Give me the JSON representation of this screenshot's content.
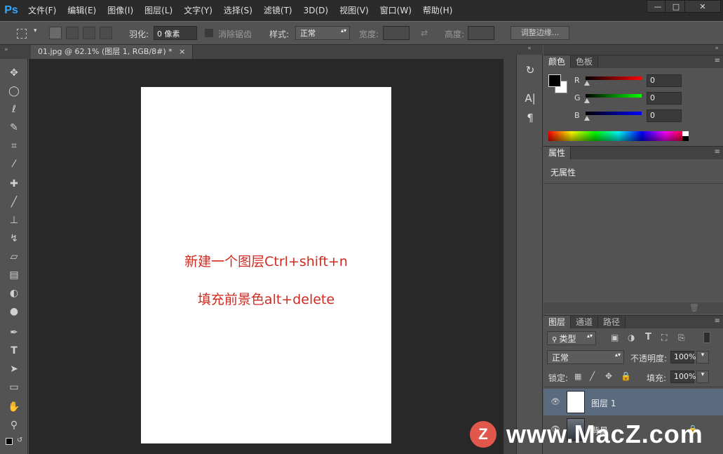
{
  "menubar": {
    "logo": "Ps",
    "items": [
      "文件(F)",
      "编辑(E)",
      "图像(I)",
      "图层(L)",
      "文字(Y)",
      "选择(S)",
      "滤镜(T)",
      "3D(D)",
      "视图(V)",
      "窗口(W)",
      "帮助(H)"
    ],
    "win_minimize": "—",
    "win_restore": "□",
    "win_close": "✕"
  },
  "options": {
    "feather_label": "羽化:",
    "feather_value": "0 像素",
    "antialias_label": "消除锯齿",
    "style_label": "样式:",
    "style_value": "正常",
    "width_label": "宽度:",
    "height_label": "高度:",
    "refine_edge": "调整边缘..."
  },
  "document": {
    "tab_title": "01.jpg @ 62.1% (图层 1, RGB/8#) *",
    "tab_close": "×",
    "line1": "新建一个图层Ctrl+shift+n",
    "line2": "填充前景色alt+delete"
  },
  "color_panel": {
    "tab_color": "颜色",
    "tab_swatches": "色板",
    "r_label": "R",
    "g_label": "G",
    "b_label": "B",
    "r_value": "0",
    "g_value": "0",
    "b_value": "0"
  },
  "properties_panel": {
    "tab": "属性",
    "content": "无属性"
  },
  "layers_panel": {
    "tab_layers": "图层",
    "tab_channels": "通道",
    "tab_paths": "路径",
    "filter_kind": "类型",
    "blend_mode": "正常",
    "opacity_label": "不透明度:",
    "opacity_value": "100%",
    "lock_label": "锁定:",
    "fill_label": "填充:",
    "fill_value": "100%",
    "layers": [
      {
        "name": "图层 1"
      },
      {
        "name": "背景"
      }
    ]
  },
  "watermark": {
    "logo": "Z",
    "text": "www.MacZ.com"
  },
  "colors": {
    "accent_ps": "#31a8ff",
    "annotation_red": "#d02a20",
    "selected_layer": "#5a6b80"
  }
}
